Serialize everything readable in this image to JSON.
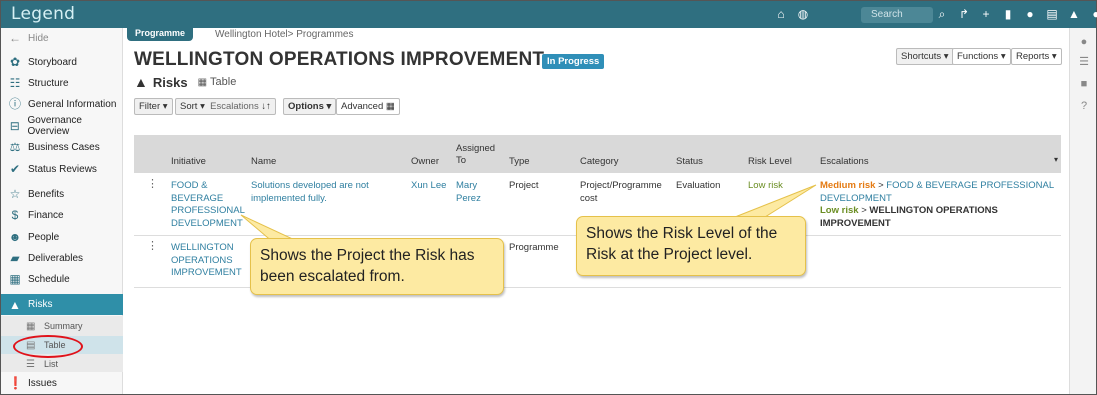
{
  "app": {
    "logo": "Legend"
  },
  "topbar": {
    "search_placeholder": "Search",
    "icons": [
      "home-icon",
      "globe-icon",
      "search-icon",
      "share-icon",
      "plus-icon",
      "bookmark-icon",
      "chat-icon",
      "document-icon",
      "bell-icon",
      "user-icon"
    ]
  },
  "sidebar": {
    "hide_label": "Hide",
    "items": [
      {
        "label": "Storyboard",
        "icon": "palette-icon"
      },
      {
        "label": "Structure",
        "icon": "structure-icon"
      },
      {
        "label": "General Information",
        "icon": "info-icon"
      },
      {
        "label": "Governance Overview",
        "icon": "governance-icon"
      },
      {
        "label": "Business Cases",
        "icon": "scales-icon"
      },
      {
        "label": "Status Reviews",
        "icon": "check-icon"
      },
      {
        "label": "Benefits",
        "icon": "star-icon"
      },
      {
        "label": "Finance",
        "icon": "dollar-icon"
      },
      {
        "label": "People",
        "icon": "people-icon"
      },
      {
        "label": "Deliverables",
        "icon": "truck-icon"
      },
      {
        "label": "Schedule",
        "icon": "calendar-icon"
      },
      {
        "label": "Risks",
        "icon": "warning-icon"
      },
      {
        "label": "Issues",
        "icon": "alert-icon"
      }
    ],
    "risk_views": [
      {
        "label": "Summary",
        "icon": "grid-icon"
      },
      {
        "label": "Table",
        "icon": "table-icon"
      },
      {
        "label": "List",
        "icon": "list-icon"
      }
    ]
  },
  "header": {
    "section_badge": "Programme",
    "breadcrumb": "Wellington Hotel> Programmes",
    "title": "WELLINGTON OPERATIONS IMPROVEMENT",
    "status": "In Progress",
    "sub_title": "Risks",
    "view_label": "Table",
    "shortcuts": "Shortcuts",
    "functions": "Functions",
    "reports": "Reports"
  },
  "toolbar": {
    "filter": "Filter",
    "sort": "Sort",
    "sort_field": "Escalations",
    "options": "Options",
    "advanced": "Advanced"
  },
  "table": {
    "columns": {
      "initiative": "Initiative",
      "name": "Name",
      "owner": "Owner",
      "assigned_1": "Assigned",
      "assigned_2": "To",
      "type": "Type",
      "category": "Category",
      "status": "Status",
      "risk_level": "Risk Level",
      "escalations": "Escalations"
    },
    "rows": [
      {
        "initiative_1": "FOOD &",
        "initiative_2": "BEVERAGE",
        "initiative_3": "PROFESSIONAL",
        "initiative_4": "DEVELOPMENT",
        "name_1": "Solutions developed are not",
        "name_2": "implemented fully.",
        "owner": "Xun Lee",
        "assigned_1": "Mary",
        "assigned_2": "Perez",
        "type": "Project",
        "category_1": "Project/Programme",
        "category_2": "cost",
        "status": "Evaluation",
        "risk_level": "Low risk",
        "esc_1_level": "Medium risk",
        "esc_1_sep": ">",
        "esc_1_target_a": "FOOD & BEVERAGE PROFESSIONAL",
        "esc_1_target_b": "DEVELOPMENT",
        "esc_2_level": "Low risk",
        "esc_2_sep": ">",
        "esc_2_target": "WELLINGTON OPERATIONS IMPROVEMENT"
      },
      {
        "initiative_1": "WELLINGTON",
        "initiative_2": "OPERATIONS",
        "initiative_3": "IMPROVEMENT",
        "type": "Programme"
      }
    ]
  },
  "callouts": {
    "left_1": "Shows the Project the Risk has",
    "left_2": "been escalated from.",
    "right_1": "Shows the Risk Level of the",
    "right_2": "Risk at the Project level."
  },
  "colors": {
    "topbar": "#2f6f80",
    "accent": "#2f8fa8",
    "link": "#2f7fa0",
    "medium_risk": "#e47a12",
    "low_risk": "#6b8e23",
    "callout_fill": "#fdeaa2",
    "callout_border": "#e5c14a",
    "highlight_ring": "#e0121a"
  }
}
